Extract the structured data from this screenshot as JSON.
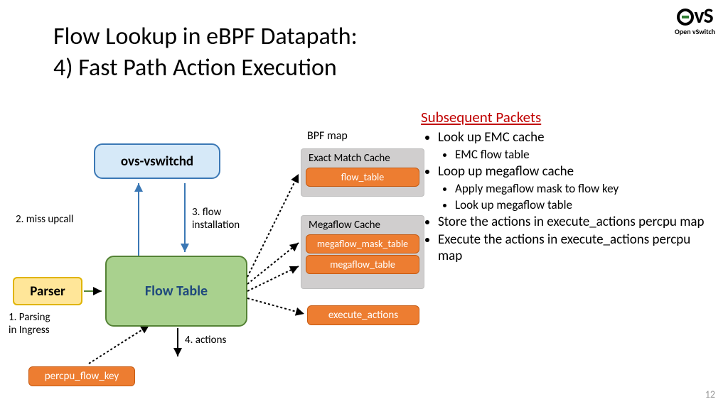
{
  "title_line1": "Flow Lookup in eBPF Datapath:",
  "title_line2": "4) Fast Path Action Execution",
  "logo": {
    "text": "Open vSwitch",
    "mark_suffix": "vS"
  },
  "diagram": {
    "vswitchd": "ovs-vswitchd",
    "parser": "Parser",
    "flow_table": "Flow Table",
    "percpu": "percpu_flow_key",
    "bpf_map_label": "BPF map",
    "emc": {
      "title": "Exact Match Cache",
      "entry": "flow_table"
    },
    "megaflow": {
      "title": "Megaflow Cache",
      "entry1": "megaflow_mask_table",
      "entry2": "megaflow_table"
    },
    "execute_actions": "execute_actions",
    "labels": {
      "parsing": "1. Parsing\nin Ingress",
      "miss": "2. miss upcall",
      "install": "3. flow\ninstallation",
      "actions": "4. actions"
    }
  },
  "side": {
    "heading": "Subsequent Packets",
    "items": [
      {
        "text": "Look up EMC cache",
        "sub": [
          "EMC flow table"
        ]
      },
      {
        "text": "Loop up megaflow cache",
        "sub": [
          "Apply megaflow mask to flow key",
          "Look up megaflow table"
        ]
      },
      {
        "text": "Store the actions in execute_actions percpu map"
      },
      {
        "text": "Execute the actions in execute_actions percpu map"
      }
    ]
  },
  "pagenum": "12"
}
